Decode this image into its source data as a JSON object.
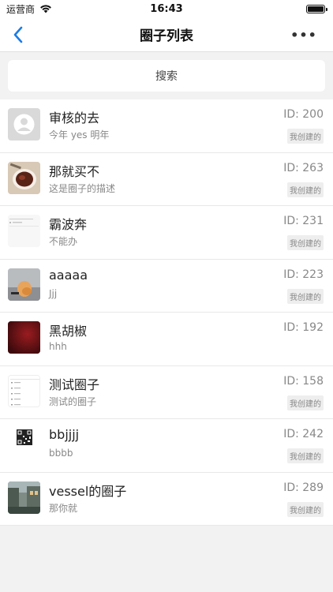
{
  "status_bar": {
    "carrier": "运营商",
    "time": "16:43"
  },
  "nav": {
    "title": "圈子列表",
    "more": "•••"
  },
  "search": {
    "placeholder": "搜索"
  },
  "items": [
    {
      "title": "审核的去",
      "desc": "今年 yes 明年",
      "id": "ID: 200",
      "badge": "我创建的",
      "thumb": "default-avatar"
    },
    {
      "title": "那就买不",
      "desc": "这是圈子的描述",
      "id": "ID: 263",
      "badge": "我创建的",
      "thumb": "food-photo"
    },
    {
      "title": "霸波奔",
      "desc": "不能办",
      "id": "ID: 231",
      "badge": "我创建的",
      "thumb": "screenshot-photo"
    },
    {
      "title": "aaaaa",
      "desc": "Jjj",
      "id": "ID: 223",
      "badge": "我创建的",
      "thumb": "hand-photo"
    },
    {
      "title": "黑胡椒",
      "desc": "hhh",
      "id": "ID: 192",
      "badge": "",
      "thumb": "dark-red-photo"
    },
    {
      "title": "测试圈子",
      "desc": "测试的圈子",
      "id": "ID: 158",
      "badge": "我创建的",
      "thumb": "list-screenshot-photo"
    },
    {
      "title": "bbjjjj",
      "desc": "bbbb",
      "id": "ID: 242",
      "badge": "我创建的",
      "thumb": "qr-code-photo"
    },
    {
      "title": "vessel的圈子",
      "desc": "那你就",
      "id": "ID: 289",
      "badge": "我创建的",
      "thumb": "street-photo"
    }
  ],
  "colors": {
    "accent": "#1a7ce6",
    "background": "#f2f2f2"
  }
}
